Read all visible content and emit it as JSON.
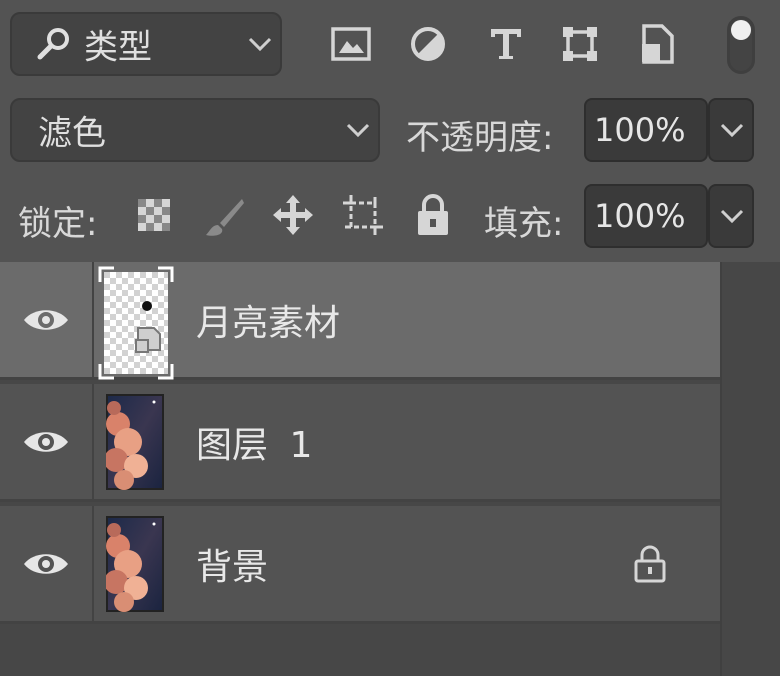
{
  "filter": {
    "icon": "search-icon",
    "kind_label": "类型",
    "filter_icons": [
      "image-filter-icon",
      "adjustment-filter-icon",
      "type-filter-icon",
      "shape-filter-icon",
      "smart-object-filter-icon"
    ],
    "toggle": "filter-toggle-switch"
  },
  "blend": {
    "mode": "滤色",
    "opacity_label": "不透明度:",
    "opacity_value": "100%"
  },
  "lock": {
    "label": "锁定:",
    "icons": [
      "lock-transparent-pixels-icon",
      "lock-image-pixels-icon",
      "lock-position-icon",
      "lock-artboard-icon",
      "lock-all-icon"
    ],
    "fill_label": "填充:",
    "fill_value": "100%"
  },
  "layers": [
    {
      "name": "月亮素材",
      "visible": true,
      "selected": true,
      "thumbnail": "smart-object-transparent",
      "locked": false
    },
    {
      "name": "图层",
      "suffix": "1",
      "visible": true,
      "selected": false,
      "thumbnail": "cloud-sky-image",
      "locked": false
    },
    {
      "name": "背景",
      "visible": true,
      "selected": false,
      "thumbnail": "cloud-sky-image",
      "locked": true
    }
  ],
  "colors": {
    "panel_bg": "#535353",
    "field_bg": "#434343",
    "selected_layer_bg": "#6b6b6b",
    "text": "#d8d8d8"
  }
}
